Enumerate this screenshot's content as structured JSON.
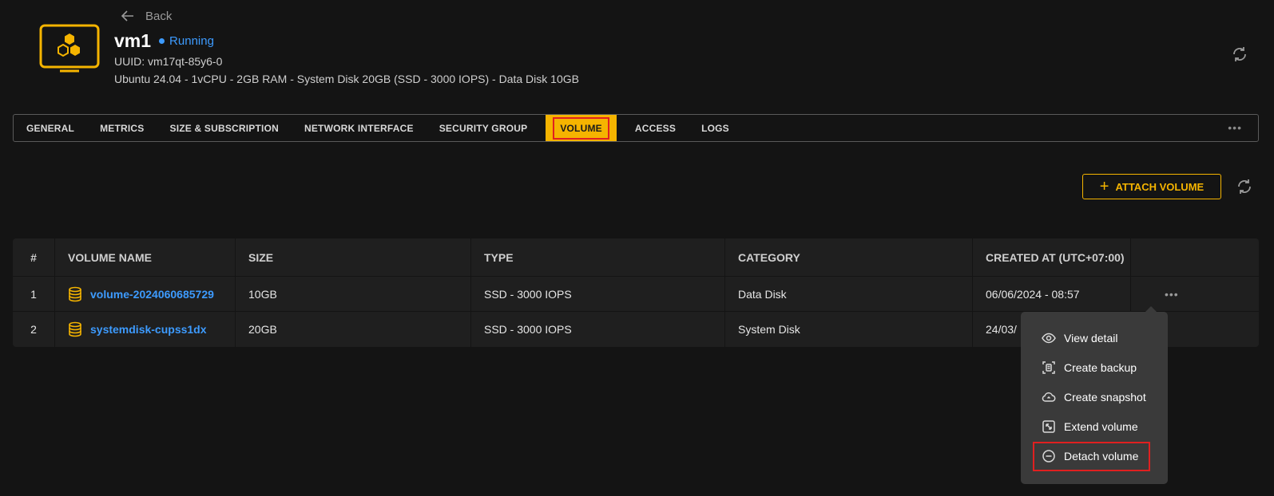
{
  "header": {
    "back_label": "Back",
    "vm_name": "vm1",
    "status": "Running",
    "uuid": "UUID: vm17qt-85y6-0",
    "specs": "Ubuntu 24.04 - 1vCPU - 2GB RAM - System Disk 20GB (SSD - 3000 IOPS) - Data Disk 10GB"
  },
  "tabs": [
    {
      "label": "GENERAL"
    },
    {
      "label": "METRICS"
    },
    {
      "label": "SIZE & SUBSCRIPTION"
    },
    {
      "label": "NETWORK INTERFACE"
    },
    {
      "label": "SECURITY GROUP"
    },
    {
      "label": "VOLUME",
      "active": true
    },
    {
      "label": "ACCESS"
    },
    {
      "label": "LOGS"
    }
  ],
  "tabs_more": "•••",
  "toolbar": {
    "attach_label": "ATTACH VOLUME"
  },
  "table": {
    "headers": [
      "#",
      "VOLUME NAME",
      "SIZE",
      "TYPE",
      "CATEGORY",
      "CREATED AT (UTC+07:00)",
      ""
    ],
    "rows": [
      {
        "index": "1",
        "name": "volume-2024060685729",
        "size": "10GB",
        "type": "SSD - 3000 IOPS",
        "category": "Data Disk",
        "created": "06/06/2024 - 08:57"
      },
      {
        "index": "2",
        "name": "systemdisk-cupss1dx",
        "size": "20GB",
        "type": "SSD - 3000 IOPS",
        "category": "System Disk",
        "created": "24/03/"
      }
    ],
    "row_menu": "•••"
  },
  "context_menu": {
    "items": [
      {
        "label": "View detail",
        "icon": "eye-icon"
      },
      {
        "label": "Create backup",
        "icon": "backup-icon"
      },
      {
        "label": "Create snapshot",
        "icon": "cloud-icon"
      },
      {
        "label": "Extend volume",
        "icon": "extend-icon"
      },
      {
        "label": "Detach volume",
        "icon": "minus-circle-icon",
        "highlighted": true
      }
    ]
  },
  "colors": {
    "accent": "#f5b400",
    "link": "#3d9bff",
    "highlight_border": "#e02020",
    "background": "#141414"
  }
}
